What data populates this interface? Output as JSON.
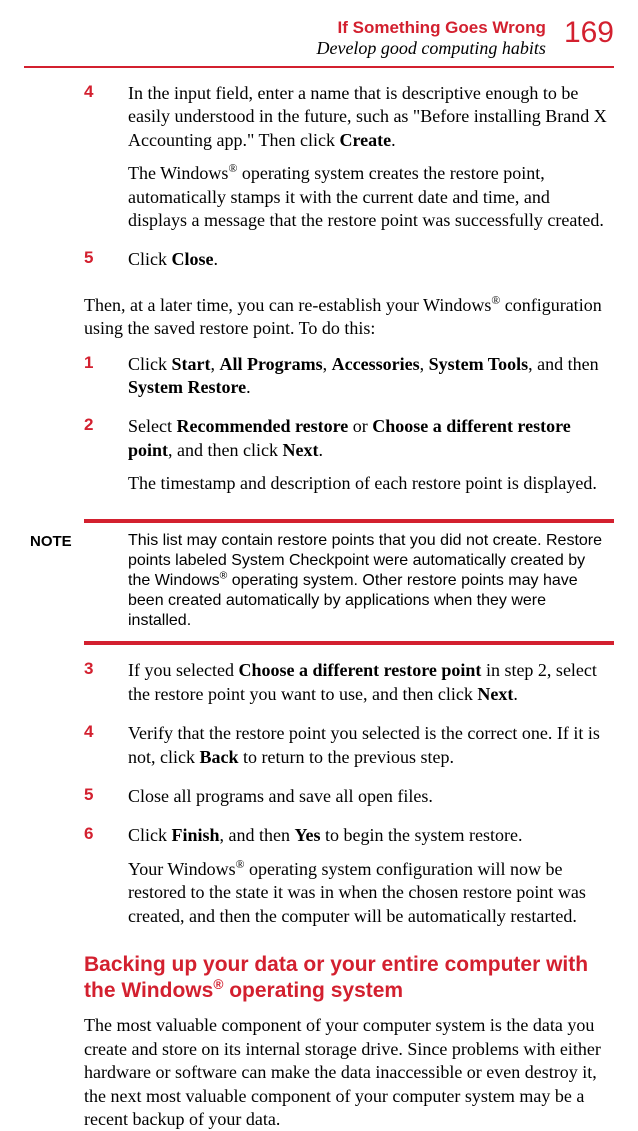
{
  "header": {
    "chapter": "If Something Goes Wrong",
    "section": "Develop good computing habits",
    "page_number": "169"
  },
  "steps_a": {
    "4_num": "4",
    "4_p1": "In the input field, enter a name that is descriptive enough to be easily understood in the future, such as \"Before installing Brand X Accounting app.\" Then click ",
    "4_p1_bold": "Create",
    "4_p1_tail": ".",
    "4_p2a": "The Windows",
    "4_p2b": " operating system creates the restore point, automatically stamps it with the current date and time, and displays a message that the restore point was successfully created.",
    "5_num": "5",
    "5_p1a": "Click ",
    "5_p1b": "Close",
    "5_p1c": "."
  },
  "intermission_a": "Then, at a later time, you can re-establish your Windows",
  "intermission_b": " configuration using the saved restore point. To do this:",
  "steps_b": {
    "1_num": "1",
    "1_a": "Click ",
    "1_b1": "Start",
    "1_c1": ", ",
    "1_b2": "All Programs",
    "1_c2": ", ",
    "1_b3": "Accessories",
    "1_c3": ", ",
    "1_b4": "System Tools",
    "1_c4": ", and then ",
    "1_b5": "System Restore",
    "1_c5": ".",
    "2_num": "2",
    "2_a": "Select ",
    "2_b1": "Recommended restore",
    "2_c1": " or ",
    "2_b2": "Choose a different restore point",
    "2_c2": ", and then click ",
    "2_b3": "Next",
    "2_c3": ".",
    "2_p2": "The timestamp and description of each restore point is displayed."
  },
  "note": {
    "label": "NOTE",
    "t1": "This list may contain restore points that you did not create. Restore points labeled System Checkpoint were automatically created by the Windows",
    "t2": " operating system. Other restore points may have been created automatically by applications when they were installed."
  },
  "steps_c": {
    "3_num": "3",
    "3_a": "If you selected ",
    "3_b1": "Choose a different restore point",
    "3_c1": " in step 2, select the restore point you want to use, and then click ",
    "3_b2": "Next",
    "3_c2": ".",
    "4_num": "4",
    "4_a": "Verify that the restore point you selected is the correct one. If it is not, click ",
    "4_b1": "Back",
    "4_c1": " to return to the previous step.",
    "5_num": "5",
    "5_a": "Close all programs and save all open files.",
    "6_num": "6",
    "6_a": "Click ",
    "6_b1": "Finish",
    "6_c1": ", and then ",
    "6_b2": "Yes",
    "6_c2": " to begin the system restore.",
    "6_p2a": "Your Windows",
    "6_p2b": " operating system configuration will now be restored to the state it was in when the chosen restore point was created, and then the computer will be automatically restarted."
  },
  "subheading_a": "Backing up your data or your entire computer with the Windows",
  "subheading_b": " operating system",
  "closing": "The most valuable component of your computer system is the data you create and store on its internal storage drive. Since problems with either hardware or software can make the data inaccessible or even destroy it, the next most valuable component of your computer system may be a recent backup of your data.",
  "reg": "®"
}
